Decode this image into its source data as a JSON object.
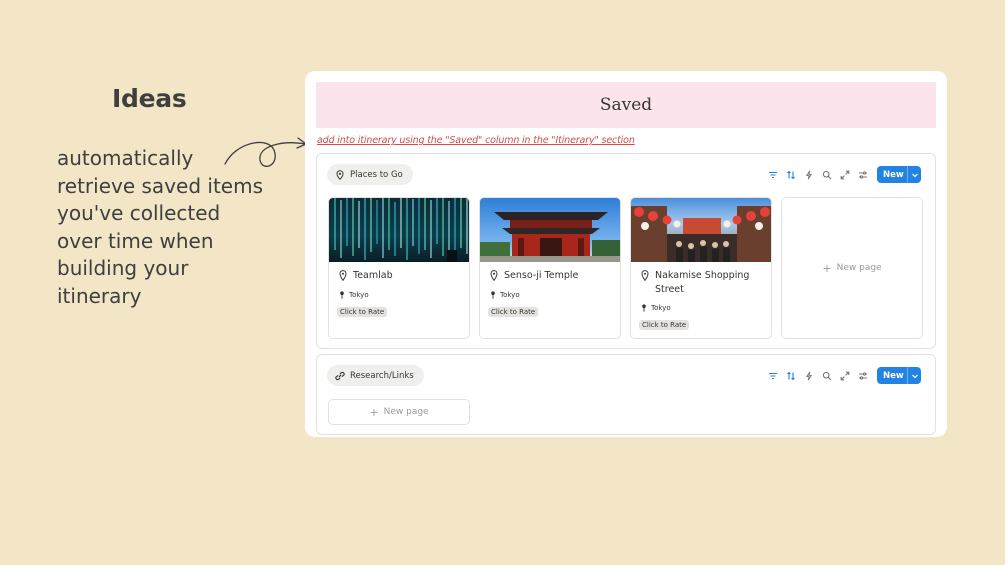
{
  "left": {
    "title": "Ideas",
    "lines": [
      "automatically",
      "retrieve saved items",
      "you've collected",
      "over time when",
      "building your",
      "itinerary"
    ]
  },
  "panel": {
    "banner_title": "Saved",
    "note": "add into itinerary using the \"Saved\" column in the \"Itinerary\" section",
    "sections": [
      {
        "name": "Places to Go",
        "icon": "map-pin-icon",
        "new_label": "New",
        "cards": [
          {
            "name": "Teamlab",
            "location": "Tokyo",
            "rate_label": "Click to Rate"
          },
          {
            "name": "Senso-ji Temple",
            "location": "Tokyo",
            "rate_label": "Click to Rate"
          },
          {
            "name": "Nakamise Shopping Street",
            "location": "Tokyo",
            "rate_label": "Click to Rate"
          }
        ],
        "new_page_label": "New page"
      },
      {
        "name": "Research/Links",
        "icon": "link-icon",
        "new_label": "New",
        "new_page_label": "New page"
      }
    ],
    "toolbar_icons": [
      "filter-icon",
      "sort-icon",
      "lightning-icon",
      "search-icon",
      "expand-icon",
      "settings-sliders-icon"
    ]
  },
  "colors": {
    "background": "#f2e6c6",
    "banner": "#fbe4ec",
    "note": "#d44c47",
    "accent": "#2383e2"
  }
}
